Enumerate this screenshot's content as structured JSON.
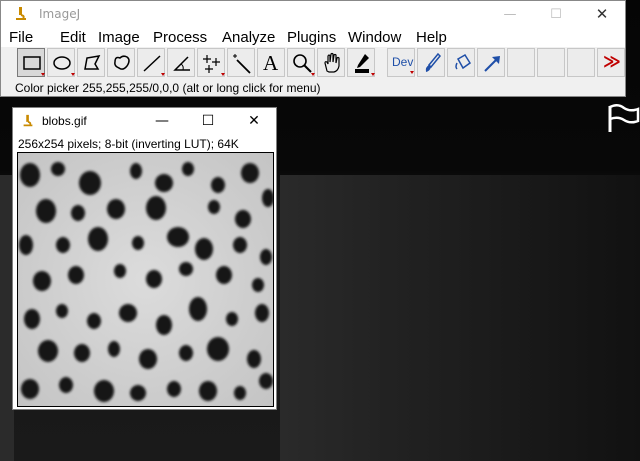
{
  "app": {
    "title": "ImageJ",
    "window_controls": {
      "minimize": "—",
      "maximize": "☐",
      "close": "✕"
    }
  },
  "menu": [
    "File",
    "Edit",
    "Image",
    "Process",
    "Analyze",
    "Plugins",
    "Window",
    "Help"
  ],
  "toolbar": {
    "tools": [
      {
        "name": "rectangle-tool",
        "icon": "rectangle-icon",
        "active": true
      },
      {
        "name": "oval-tool",
        "icon": "oval-icon"
      },
      {
        "name": "polygon-tool",
        "icon": "polygon-icon"
      },
      {
        "name": "freehand-tool",
        "icon": "freehand-icon"
      },
      {
        "name": "line-tool",
        "icon": "line-icon"
      },
      {
        "name": "angle-tool",
        "icon": "angle-icon"
      },
      {
        "name": "point-tool",
        "icon": "multipoint-icon"
      },
      {
        "name": "wand-tool",
        "icon": "wand-icon"
      },
      {
        "name": "text-tool",
        "icon": "text-icon"
      },
      {
        "name": "zoom-tool",
        "icon": "magnifier-icon"
      },
      {
        "name": "hand-tool",
        "icon": "hand-icon"
      },
      {
        "name": "color-picker-tool",
        "icon": "dropper-icon"
      },
      {
        "name": "dev-tool",
        "icon": "dev-icon",
        "label": "Dev"
      },
      {
        "name": "brush-tool",
        "icon": "brush-icon"
      },
      {
        "name": "flood-fill-tool",
        "icon": "flood-fill-icon"
      },
      {
        "name": "arrow-tool",
        "icon": "arrow-icon"
      },
      {
        "name": "empty-slot-1",
        "icon": ""
      },
      {
        "name": "empty-slot-2",
        "icon": ""
      },
      {
        "name": "empty-slot-3",
        "icon": ""
      },
      {
        "name": "more-tools",
        "icon": "double-chevron-icon",
        "label": "≫"
      }
    ],
    "dev_label": "Dev",
    "more_label": "≫",
    "text_tool_label": "A"
  },
  "status": "Color picker 255,255,255/0,0,0 (alt or long click for menu)",
  "image_window": {
    "title": "blobs.gif",
    "info": "256x254 pixels; 8-bit (inverting LUT); 64K",
    "controls": {
      "minimize": "—",
      "maximize": "☐",
      "close": "✕"
    }
  },
  "colors": {
    "blob": "#141414",
    "background": "#d4d4d4",
    "accent_red": "#c00000",
    "accent_blue": "#1f4fa8"
  }
}
